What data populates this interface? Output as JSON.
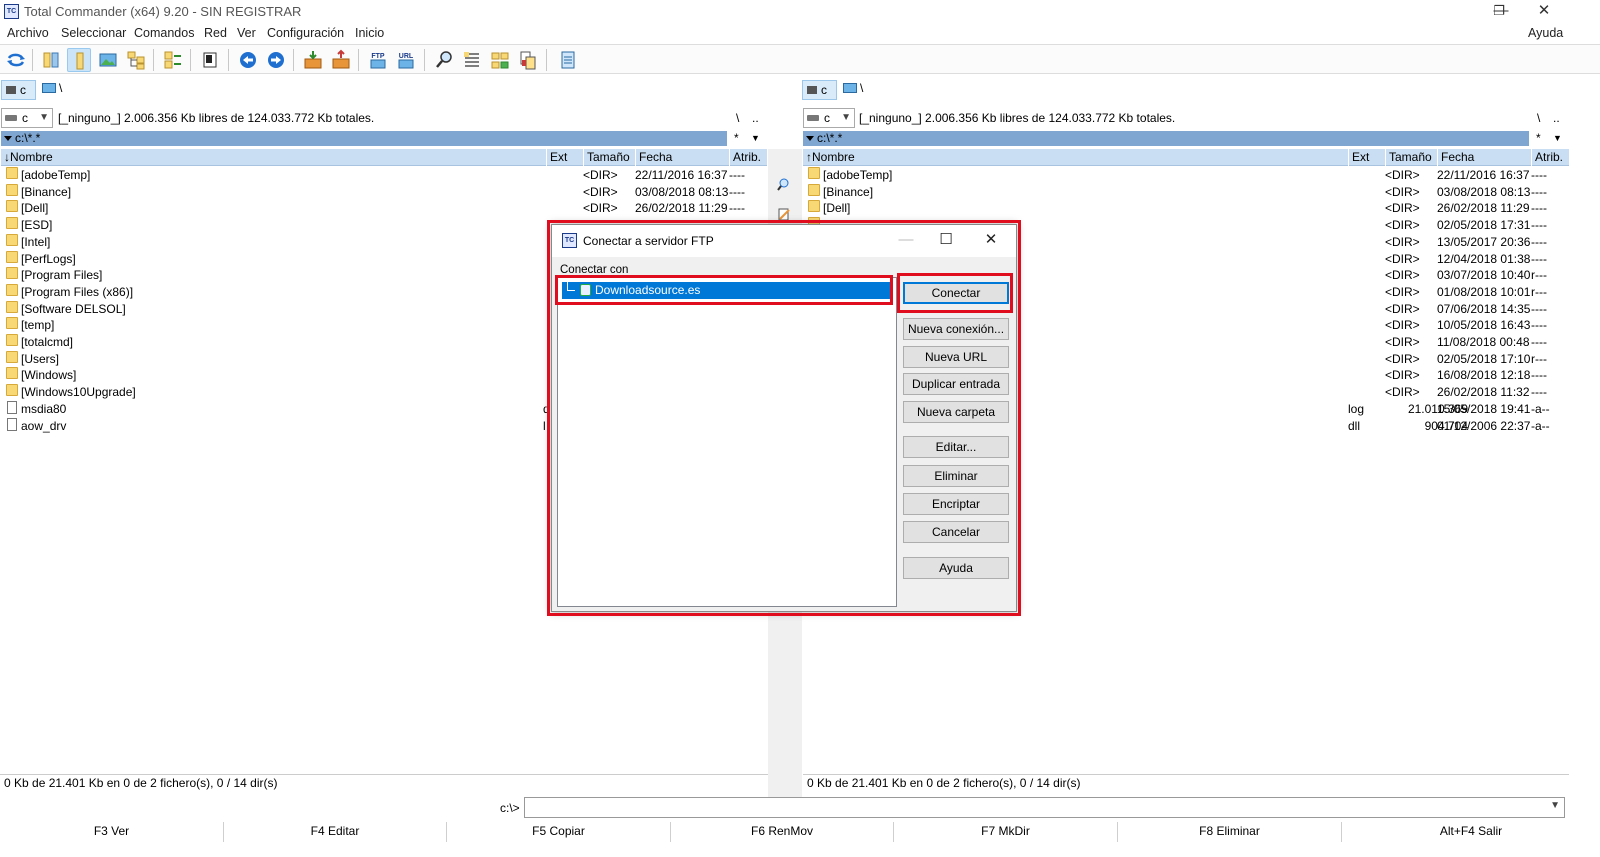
{
  "window": {
    "title": "Total Commander (x64) 9.20 - SIN REGISTRAR",
    "app_icon_text": "TC",
    "controls": {
      "minimize": "—",
      "maximize": "❐",
      "close": "✕"
    }
  },
  "menu": {
    "items": [
      "Archivo",
      "Seleccionar",
      "Comandos",
      "Red",
      "Ver",
      "Configuración",
      "Inicio"
    ],
    "help": "Ayuda"
  },
  "toolbar": {
    "icons": [
      "refresh-icon",
      "brief-view-icon",
      "full-view-icon",
      "thumbnails-icon",
      "tree-icon",
      "compare-dirs-icon",
      "quick-view-icon",
      "back-icon",
      "forward-icon",
      "pack-icon",
      "unpack-icon",
      "ftp-connect-icon",
      "url-connect-icon",
      "search-icon",
      "multi-rename-icon",
      "sync-dirs-icon",
      "compare-files-icon",
      "notepad-icon"
    ],
    "ftp_label": "FTP",
    "url_label": "URL"
  },
  "left": {
    "drive_tab": "c",
    "path_tab": "\\",
    "drive_select": "c",
    "free_info": "[_ninguno_]  2.006.356 Kb libres de 124.033.772 Kb totales.",
    "root_btn": "\\",
    "up_btn": "..",
    "path": "c:\\*.*",
    "path_extra": "*",
    "columns": {
      "name": "Nombre",
      "ext": "Ext",
      "size": "Tamaño",
      "date": "Fecha",
      "attr": "Atrib."
    },
    "rows": [
      {
        "name": "[adobeTemp]",
        "ext": "",
        "size": "<DIR>",
        "date": "22/11/2016 16:37",
        "attr": "----",
        "type": "folder"
      },
      {
        "name": "[Binance]",
        "ext": "",
        "size": "<DIR>",
        "date": "03/08/2018 08:13",
        "attr": "----",
        "type": "folder"
      },
      {
        "name": "[Dell]",
        "ext": "",
        "size": "<DIR>",
        "date": "26/02/2018 11:29",
        "attr": "----",
        "type": "folder"
      },
      {
        "name": "[ESD]",
        "ext": "",
        "size": "",
        "date": "",
        "attr": "",
        "type": "folder"
      },
      {
        "name": "[Intel]",
        "ext": "",
        "size": "",
        "date": "",
        "attr": "",
        "type": "folder"
      },
      {
        "name": "[PerfLogs]",
        "ext": "",
        "size": "",
        "date": "",
        "attr": "",
        "type": "folder"
      },
      {
        "name": "[Program Files]",
        "ext": "",
        "size": "",
        "date": "",
        "attr": "",
        "type": "folder"
      },
      {
        "name": "[Program Files (x86)]",
        "ext": "",
        "size": "",
        "date": "",
        "attr": "",
        "type": "folder"
      },
      {
        "name": "[Software DELSOL]",
        "ext": "",
        "size": "",
        "date": "",
        "attr": "",
        "type": "folder"
      },
      {
        "name": "[temp]",
        "ext": "",
        "size": "",
        "date": "",
        "attr": "",
        "type": "folder"
      },
      {
        "name": "[totalcmd]",
        "ext": "",
        "size": "",
        "date": "",
        "attr": "",
        "type": "folder"
      },
      {
        "name": "[Users]",
        "ext": "",
        "size": "",
        "date": "",
        "attr": "",
        "type": "folder"
      },
      {
        "name": "[Windows]",
        "ext": "",
        "size": "",
        "date": "",
        "attr": "",
        "type": "folder"
      },
      {
        "name": "[Windows10Upgrade]",
        "ext": "",
        "size": "",
        "date": "",
        "attr": "",
        "type": "folder"
      },
      {
        "name": "msdia80",
        "ext": "d",
        "size": "",
        "date": "",
        "attr": "",
        "type": "file"
      },
      {
        "name": "aow_drv",
        "ext": "l",
        "size": "",
        "date": "",
        "attr": "",
        "type": "file"
      }
    ],
    "status": "0 Kb de 21.401 Kb en 0 de 2 fichero(s), 0 / 14 dir(s)"
  },
  "right": {
    "drive_tab": "c",
    "path_tab": "\\",
    "drive_select": "c",
    "free_info": "[_ninguno_]  2.006.356 Kb libres de 124.033.772 Kb totales.",
    "root_btn": "\\",
    "up_btn": "..",
    "path": "c:\\*.*",
    "path_extra": "*",
    "columns": {
      "name": "Nombre",
      "ext": "Ext",
      "size": "Tamaño",
      "date": "Fecha",
      "attr": "Atrib."
    },
    "rows": [
      {
        "name": "[adobeTemp]",
        "ext": "",
        "size": "<DIR>",
        "date": "22/11/2016 16:37",
        "attr": "----",
        "type": "folder"
      },
      {
        "name": "[Binance]",
        "ext": "",
        "size": "<DIR>",
        "date": "03/08/2018 08:13",
        "attr": "----",
        "type": "folder"
      },
      {
        "name": "[Dell]",
        "ext": "",
        "size": "<DIR>",
        "date": "26/02/2018 11:29",
        "attr": "----",
        "type": "folder"
      },
      {
        "name": "",
        "ext": "",
        "size": "<DIR>",
        "date": "02/05/2018 17:31",
        "attr": "----",
        "type": "folder"
      },
      {
        "name": "",
        "ext": "",
        "size": "<DIR>",
        "date": "13/05/2017 20:36",
        "attr": "----",
        "type": "folder"
      },
      {
        "name": "",
        "ext": "",
        "size": "<DIR>",
        "date": "12/04/2018 01:38",
        "attr": "----",
        "type": "folder"
      },
      {
        "name": "",
        "ext": "",
        "size": "<DIR>",
        "date": "03/07/2018 10:40",
        "attr": "r---",
        "type": "folder"
      },
      {
        "name": "",
        "ext": "",
        "size": "<DIR>",
        "date": "01/08/2018 10:01",
        "attr": "r---",
        "type": "folder"
      },
      {
        "name": "",
        "ext": "",
        "size": "<DIR>",
        "date": "07/06/2018 14:35",
        "attr": "----",
        "type": "folder"
      },
      {
        "name": "",
        "ext": "",
        "size": "<DIR>",
        "date": "10/05/2018 16:43",
        "attr": "----",
        "type": "folder"
      },
      {
        "name": "",
        "ext": "",
        "size": "<DIR>",
        "date": "11/08/2018 00:48",
        "attr": "----",
        "type": "folder"
      },
      {
        "name": "",
        "ext": "",
        "size": "<DIR>",
        "date": "02/05/2018 17:10",
        "attr": "r---",
        "type": "folder"
      },
      {
        "name": "",
        "ext": "",
        "size": "<DIR>",
        "date": "16/08/2018 12:18",
        "attr": "----",
        "type": "folder"
      },
      {
        "name": "",
        "ext": "",
        "size": "<DIR>",
        "date": "26/02/2018 11:32",
        "attr": "----",
        "type": "folder"
      },
      {
        "name": "",
        "ext": "log",
        "size": "21.010.369",
        "date": "15/05/2018 19:41",
        "attr": "-a--",
        "type": "file"
      },
      {
        "name": "",
        "ext": "dll",
        "size": "904.704",
        "date": "01/12/2006 22:37",
        "attr": "-a--",
        "type": "file"
      }
    ],
    "status": "0 Kb de 21.401 Kb en 0 de 2 fichero(s), 0 / 14 dir(s)"
  },
  "cmdline": {
    "label": "c:\\>",
    "value": ""
  },
  "fkeys": [
    "F3 Ver",
    "F4 Editar",
    "F5 Copiar",
    "F6 RenMov",
    "F7 MkDir",
    "F8 Eliminar",
    "Alt+F4 Salir"
  ],
  "dialog": {
    "title": "Conectar a servidor FTP",
    "icon_text": "TC",
    "controls": {
      "minimize": "—",
      "maximize": "☐",
      "close": "✕"
    },
    "connect_label": "Conectar con",
    "connections": [
      "Downloadsource.es"
    ],
    "buttons": {
      "connect": "Conectar",
      "new_connection": "Nueva conexión...",
      "new_url": "Nueva URL",
      "duplicate": "Duplicar entrada",
      "new_folder": "Nueva carpeta",
      "edit": "Editar...",
      "delete": "Eliminar",
      "encrypt": "Encriptar",
      "cancel": "Cancelar",
      "help": "Ayuda"
    }
  },
  "colors": {
    "highlight_box": "#e00d1f",
    "selection": "#0078d7",
    "path_bar": "#7fa6d1",
    "column_header": "#c9def2"
  }
}
